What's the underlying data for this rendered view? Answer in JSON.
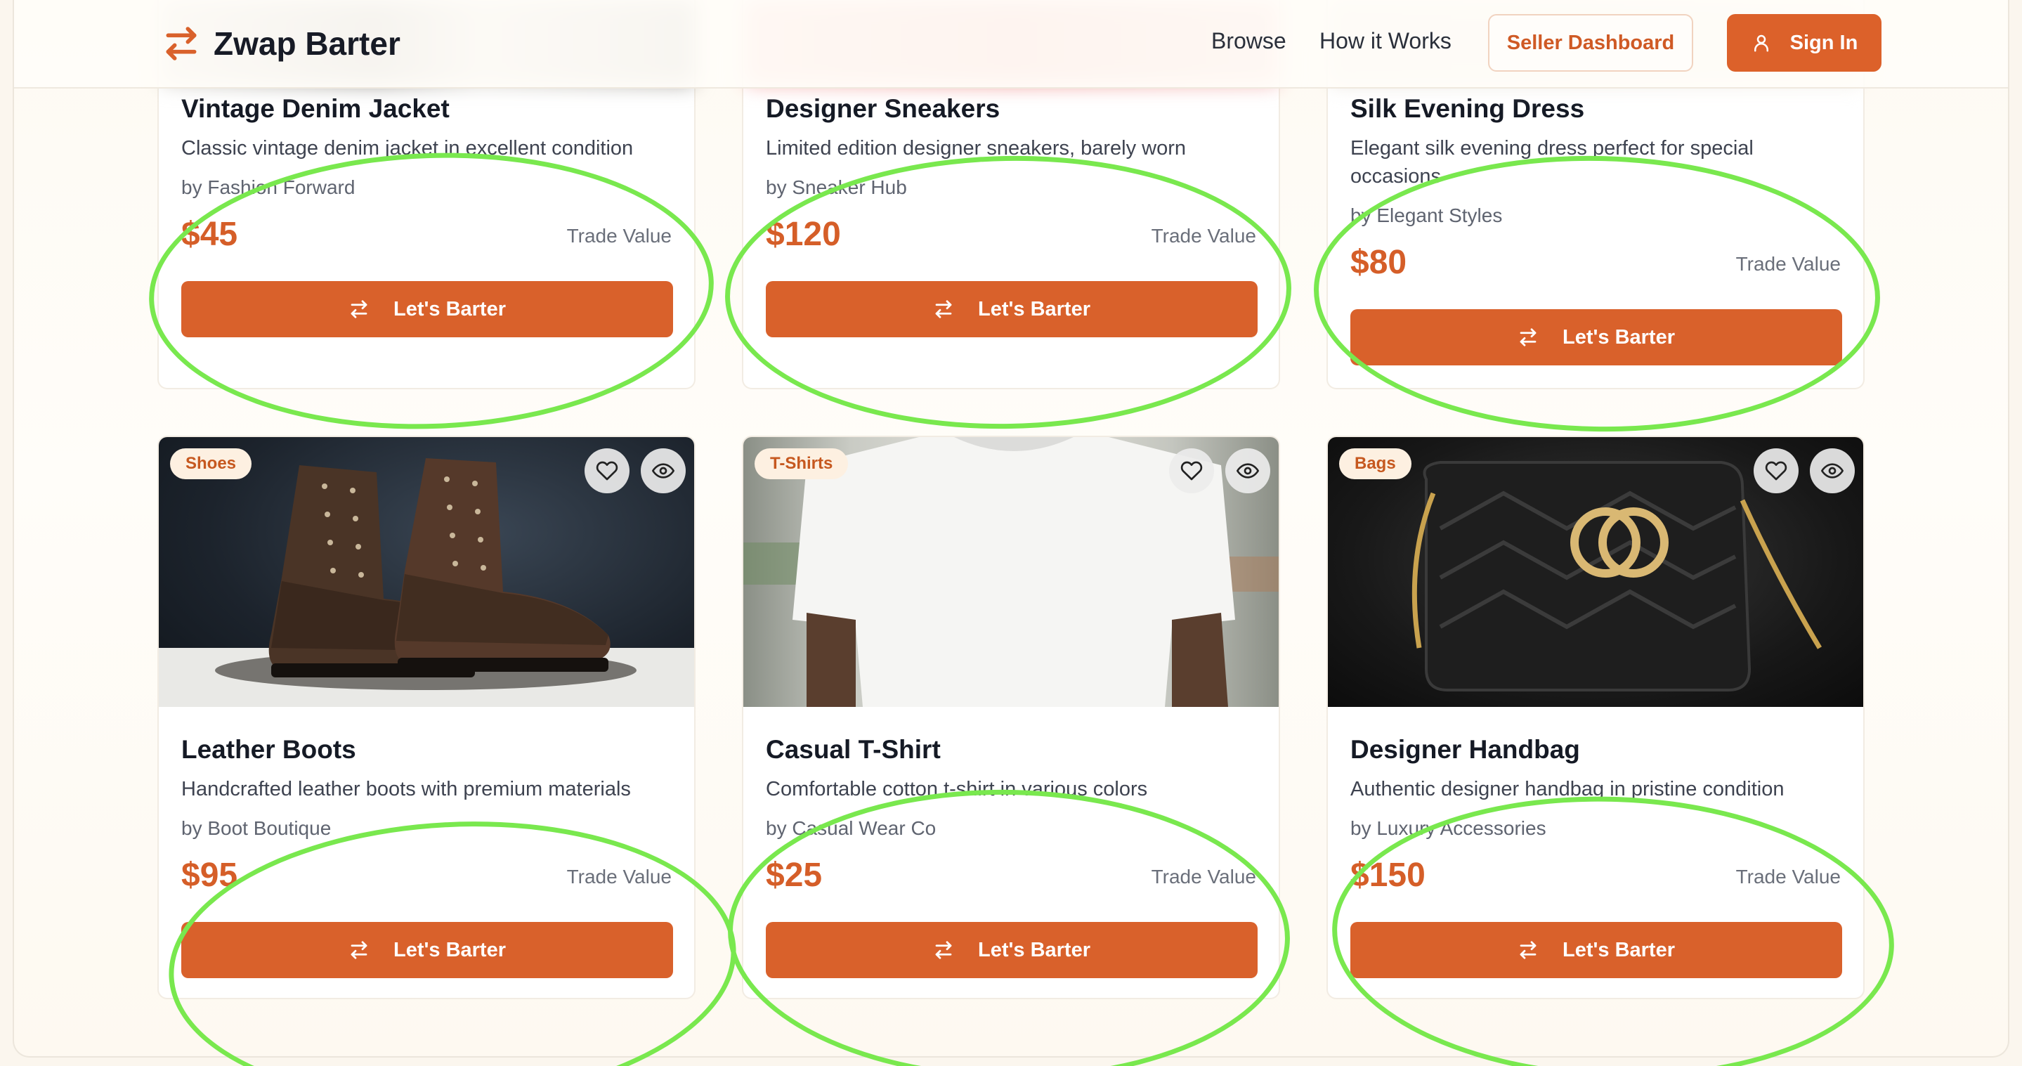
{
  "header": {
    "brand": "Zwap Barter",
    "nav": [
      {
        "label": "Browse"
      },
      {
        "label": "How it Works"
      }
    ],
    "seller_dashboard_label": "Seller Dashboard",
    "sign_in_label": "Sign In"
  },
  "colors": {
    "accent": "#d9612b",
    "highlight_annotation": "#79e84e",
    "badge_bg": "#fdf0e1"
  },
  "products": [
    {
      "title": "Vintage Denim Jacket",
      "description": "Classic vintage denim jacket in excellent condition",
      "seller": "by Fashion Forward",
      "price": "$45",
      "price_caption": "Trade Value",
      "action": "Let's Barter"
    },
    {
      "title": "Designer Sneakers",
      "description": "Limited edition designer sneakers, barely worn",
      "seller": "by Sneaker Hub",
      "price": "$120",
      "price_caption": "Trade Value",
      "action": "Let's Barter"
    },
    {
      "title": "Silk Evening Dress",
      "description": "Elegant silk evening dress perfect for special occasions",
      "seller": "by Elegant Styles",
      "price": "$80",
      "price_caption": "Trade Value",
      "action": "Let's Barter"
    },
    {
      "category": "Shoes",
      "title": "Leather Boots",
      "description": "Handcrafted leather boots with premium materials",
      "seller": "by Boot Boutique",
      "price": "$95",
      "price_caption": "Trade Value",
      "action": "Let's Barter",
      "image_icon": "boots-image"
    },
    {
      "category": "T-Shirts",
      "title": "Casual T-Shirt",
      "description": "Comfortable cotton t-shirt in various colors",
      "seller": "by Casual Wear Co",
      "price": "$25",
      "price_caption": "Trade Value",
      "action": "Let's Barter",
      "image_icon": "tshirt-image"
    },
    {
      "category": "Bags",
      "title": "Designer Handbag",
      "description": "Authentic designer handbag in pristine condition",
      "seller": "by Luxury Accessories",
      "price": "$150",
      "price_caption": "Trade Value",
      "action": "Let's Barter",
      "image_icon": "handbag-image"
    }
  ]
}
